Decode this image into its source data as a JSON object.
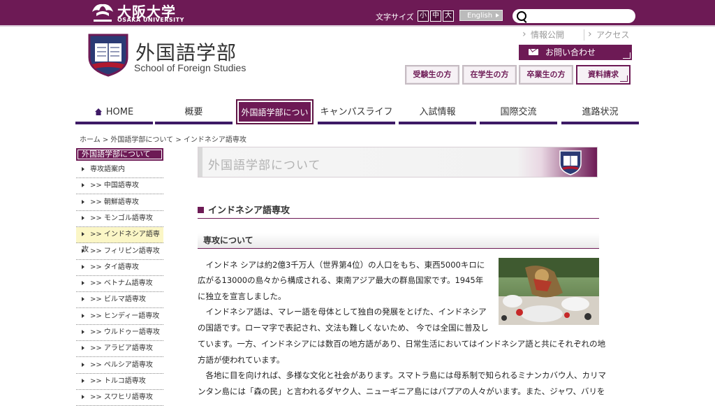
{
  "topbar": {
    "univ_name_ja": "大阪大学",
    "univ_name_en": "OSAKA UNIVERSITY",
    "font_size_label": "文字サイズ",
    "font_sizes": [
      "小",
      "中",
      "大"
    ],
    "english_label": "English",
    "search_placeholder": ""
  },
  "header": {
    "faculty_ja": "外国語学部",
    "faculty_en": "School of Foreign Studies",
    "util_links": [
      "情報公開",
      "アクセス"
    ],
    "contact_label": "お問い合わせ",
    "audience_buttons": [
      "受験生の方",
      "在学生の方",
      "卒業生の方"
    ],
    "request_label": "資料請求"
  },
  "nav": {
    "items": [
      "HOME",
      "概要",
      "外国語学部について",
      "キャンパスライフ",
      "入試情報",
      "国際交流",
      "進路状況"
    ],
    "active_index": 2
  },
  "breadcrumb": "ホーム > 外国語学部について > インドネシア語専攻",
  "sidebar": {
    "title": "外国語学部について",
    "items": [
      "専攻語案内",
      ">> 中国語専攻",
      ">> 朝鮮語専攻",
      ">> モンゴル語専攻",
      ">> インドネシア語専攻",
      ">> フィリピン語専攻",
      ">> タイ語専攻",
      ">> ベトナム語専攻",
      ">> ビルマ語専攻",
      ">> ヒンディー語専攻",
      ">> ウルドゥー語専攻",
      ">> アラビア語専攻",
      ">> ペルシア語専攻",
      ">> トルコ語専攻",
      ">> スワヒリ語専攻"
    ],
    "active_index": 4
  },
  "main": {
    "banner_title": "外国語学部について",
    "section_title": "インドネシア語専攻",
    "sub_title": "専攻について",
    "lines": [
      "　インドネ シアは約2億3千万人（世界第4位）の人口をもち、東西5000キロに",
      "広がる13000の島々から構成される、東南アジア最大の群島国家です。1945年",
      "に独立を宣言しました。",
      "　インドネシア語は、マレー語を母体として独自の発展をとげた、インドネシア",
      "の国語です。ローマ字で表記され、文法も難しくないため、 今では全国に普及し",
      "ています。一方、インドネシアには数百の地方語があり、日常生活においてはインドネシア語と共にそれぞれの地",
      "方語が使われています。",
      "　各地に目を向ければ、多様な文化と社会があります。スマトラ島には母系制で知られるミナンカバウ人、カリマ",
      "ンタン島には「森の民」と言われるダヤク人、ニューギニア島にはパプアの人々がいます。また、ジャワ、バリを"
    ]
  },
  "colors": {
    "brand": "#6d1a55",
    "nav_underline": "#3e1a66",
    "sidebar_active": "#fbf6c6"
  }
}
